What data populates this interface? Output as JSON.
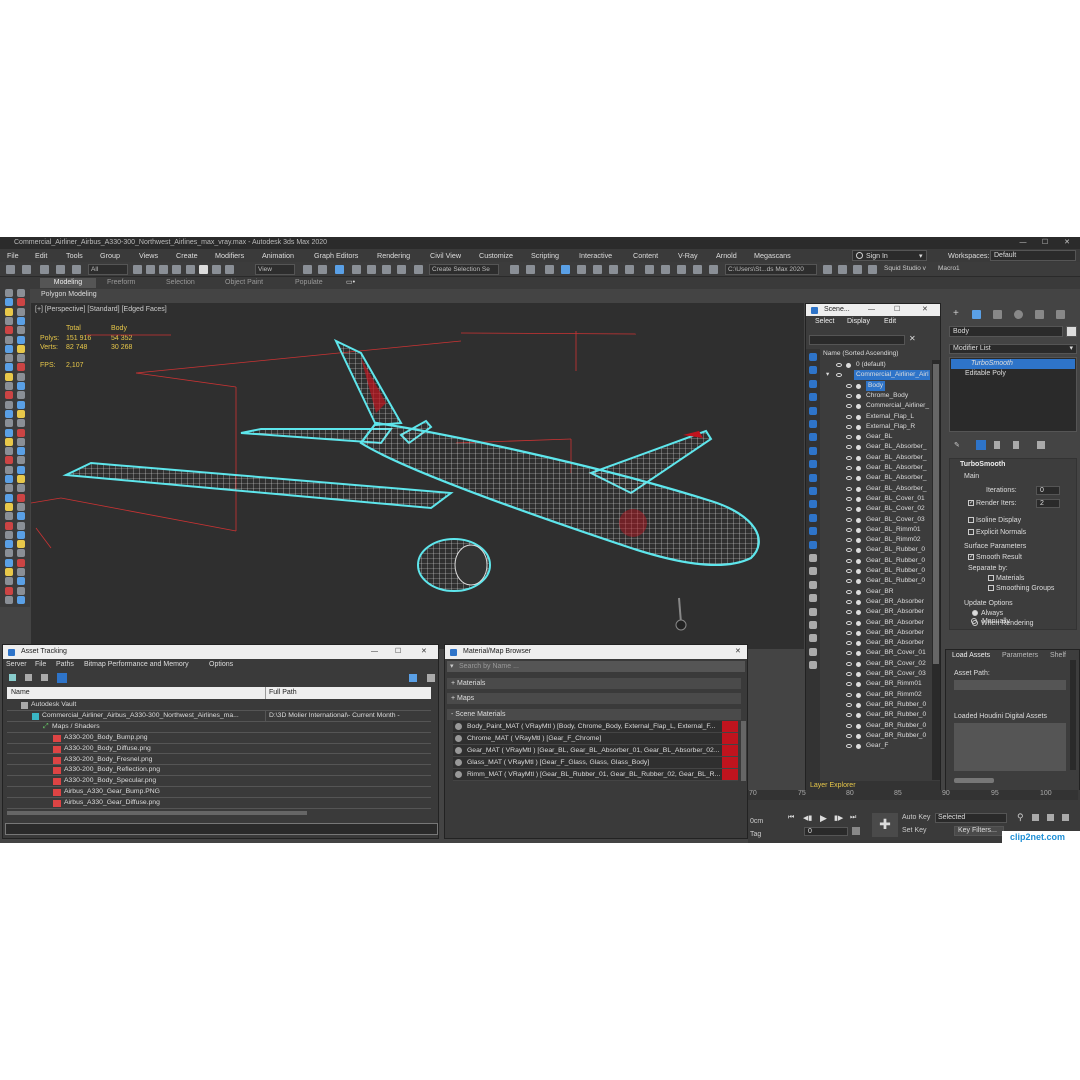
{
  "window": {
    "title": "Commercial_Airliner_Airbus_A330-300_Northwest_Airlines_max_vray.max - Autodesk 3ds Max 2020"
  },
  "menu": [
    "File",
    "Edit",
    "Tools",
    "Group",
    "Views",
    "Create",
    "Modifiers",
    "Animation",
    "Graph Editors",
    "Rendering",
    "Civil View",
    "Customize",
    "Scripting",
    "Interactive",
    "Content",
    "V-Ray",
    "Arnold",
    "Megascans"
  ],
  "signin": {
    "label": "Sign In",
    "workspaces_label": "Workspaces:",
    "workspaces_value": "Default"
  },
  "toolbar": {
    "filter": "All",
    "refcoord": "View",
    "selection_set": "Create Selection Se",
    "path": "C:\\Users\\St...ds Max 2020",
    "squid": "Squid Studio v",
    "macro": "Macro1"
  },
  "ribbon": {
    "tabs": [
      "Modeling",
      "Freeform",
      "Selection",
      "Object Paint",
      "Populate"
    ],
    "sub": "Polygon Modeling"
  },
  "viewport": {
    "label": "[+] [Perspective] [Standard] [Edged Faces]",
    "stats": {
      "total_label": "Total",
      "body_label": "Body",
      "polys_label": "Polys:",
      "polys_total": "151 916",
      "polys_body": "54 352",
      "verts_label": "Verts:",
      "verts_total": "82 748",
      "verts_body": "30 268",
      "fps_label": "FPS:",
      "fps": "2,107"
    }
  },
  "scene_explorer": {
    "title": "Scene...",
    "menu": [
      "Select",
      "Display",
      "Edit"
    ],
    "header": "Name (Sorted Ascending)",
    "items": [
      "0 (default)",
      "Commercial_Airliner_Airl",
      "Body",
      "Chrome_Body",
      "Commercial_Airliner_",
      "External_Flap_L",
      "External_Flap_R",
      "Gear_BL",
      "Gear_BL_Absorber_",
      "Gear_BL_Absorber_",
      "Gear_BL_Absorber_",
      "Gear_BL_Absorber_",
      "Gear_BL_Absorber_",
      "Gear_BL_Cover_01",
      "Gear_BL_Cover_02",
      "Gear_BL_Cover_03",
      "Gear_BL_Rimm01",
      "Gear_BL_Rimm02",
      "Gear_BL_Rubber_0",
      "Gear_BL_Rubber_0",
      "Gear_BL_Rubber_0",
      "Gear_BL_Rubber_0",
      "Gear_BR",
      "Gear_BR_Absorber",
      "Gear_BR_Absorber",
      "Gear_BR_Absorber",
      "Gear_BR_Absorber",
      "Gear_BR_Absorber",
      "Gear_BR_Cover_01",
      "Gear_BR_Cover_02",
      "Gear_BR_Cover_03",
      "Gear_BR_Rimm01",
      "Gear_BR_Rimm02",
      "Gear_BR_Rubber_0",
      "Gear_BR_Rubber_0",
      "Gear_BR_Rubber_0",
      "Gear_BR_Rubber_0",
      "Gear_F"
    ],
    "layer_explorer": "Layer Explorer"
  },
  "command_panel": {
    "object_name": "Body",
    "modifier_list": "Modifier List",
    "stack": [
      "TurboSmooth",
      "Editable Poly"
    ],
    "rollout": "TurboSmooth",
    "main": "Main",
    "iterations_label": "Iterations:",
    "iterations": "0",
    "render_iters_label": "Render Iters:",
    "render_iters": "2",
    "isoline": "Isoline Display",
    "explicit": "Explicit Normals",
    "surface": "Surface Parameters",
    "smooth_result": "Smooth Result",
    "separate_by": "Separate by:",
    "materials": "Materials",
    "smoothing_groups": "Smoothing Groups",
    "update_options": "Update Options",
    "always": "Always",
    "when_rendering": "When Rendering",
    "manually": "Manually",
    "tabs": [
      "Load Assets",
      "Parameters",
      "Shelf"
    ],
    "asset_path": "Asset Path:",
    "houdini": "Loaded Houdini Digital Assets"
  },
  "asset_tracking": {
    "title": "Asset Tracking",
    "menu": [
      "Server",
      "File",
      "Paths",
      "Bitmap Performance and Memory",
      "Options"
    ],
    "col_name": "Name",
    "col_path": "Full Path",
    "rows": [
      {
        "name": "Autodesk Vault",
        "path": ""
      },
      {
        "name": "Commercial_Airliner_Airbus_A330-300_Northwest_Airlines_ma...",
        "path": "D:\\3D Molier International\\- Current Month -"
      },
      {
        "name": "Maps / Shaders",
        "path": ""
      },
      {
        "name": "A330-200_Body_Bump.png",
        "path": ""
      },
      {
        "name": "A330-200_Body_Diffuse.png",
        "path": ""
      },
      {
        "name": "A330-200_Body_Fresnel.png",
        "path": ""
      },
      {
        "name": "A330-200_Body_Reflection.png",
        "path": ""
      },
      {
        "name": "A330-200_Body_Specular.png",
        "path": ""
      },
      {
        "name": "Airbus_A330_Gear_Bump.PNG",
        "path": ""
      },
      {
        "name": "Airbus_A330_Gear_Diffuse.png",
        "path": ""
      }
    ]
  },
  "material_browser": {
    "title": "Material/Map Browser",
    "search": "Search by Name ...",
    "groups": [
      "+ Materials",
      "+ Maps",
      "- Scene Materials"
    ],
    "materials": [
      "Body_Paint_MAT ( VRayMtl ) [Body, Chrome_Body, External_Flap_L, External_F...",
      "Chrome_MAT ( VRayMtl ) [Gear_F_Chrome]",
      "Gear_MAT ( VRayMtl ) [Gear_BL, Gear_BL_Absorber_01, Gear_BL_Absorber_02...",
      "Glass_MAT ( VRayMtl ) [Gear_F_Glass, Glass, Glass_Body]",
      "Rimm_MAT ( VRayMtl ) [Gear_BL_Rubber_01, Gear_BL_Rubber_02, Gear_BL_R..."
    ]
  },
  "timeline": {
    "ticks": [
      "70",
      "75",
      "80",
      "85",
      "90",
      "95",
      "100"
    ],
    "frame": "0",
    "auto_key": "Auto Key",
    "set_key": "Set Key",
    "selected": "Selected",
    "key_filters": "Key Filters...",
    "time_lbl": "0cm",
    "tag_lbl": "Tag"
  },
  "watermark": "clip2net.com",
  "colors": {
    "accent": "#2e74c9",
    "wire_highlight": "#5ee6ec",
    "brand_red": "#c0141e"
  }
}
